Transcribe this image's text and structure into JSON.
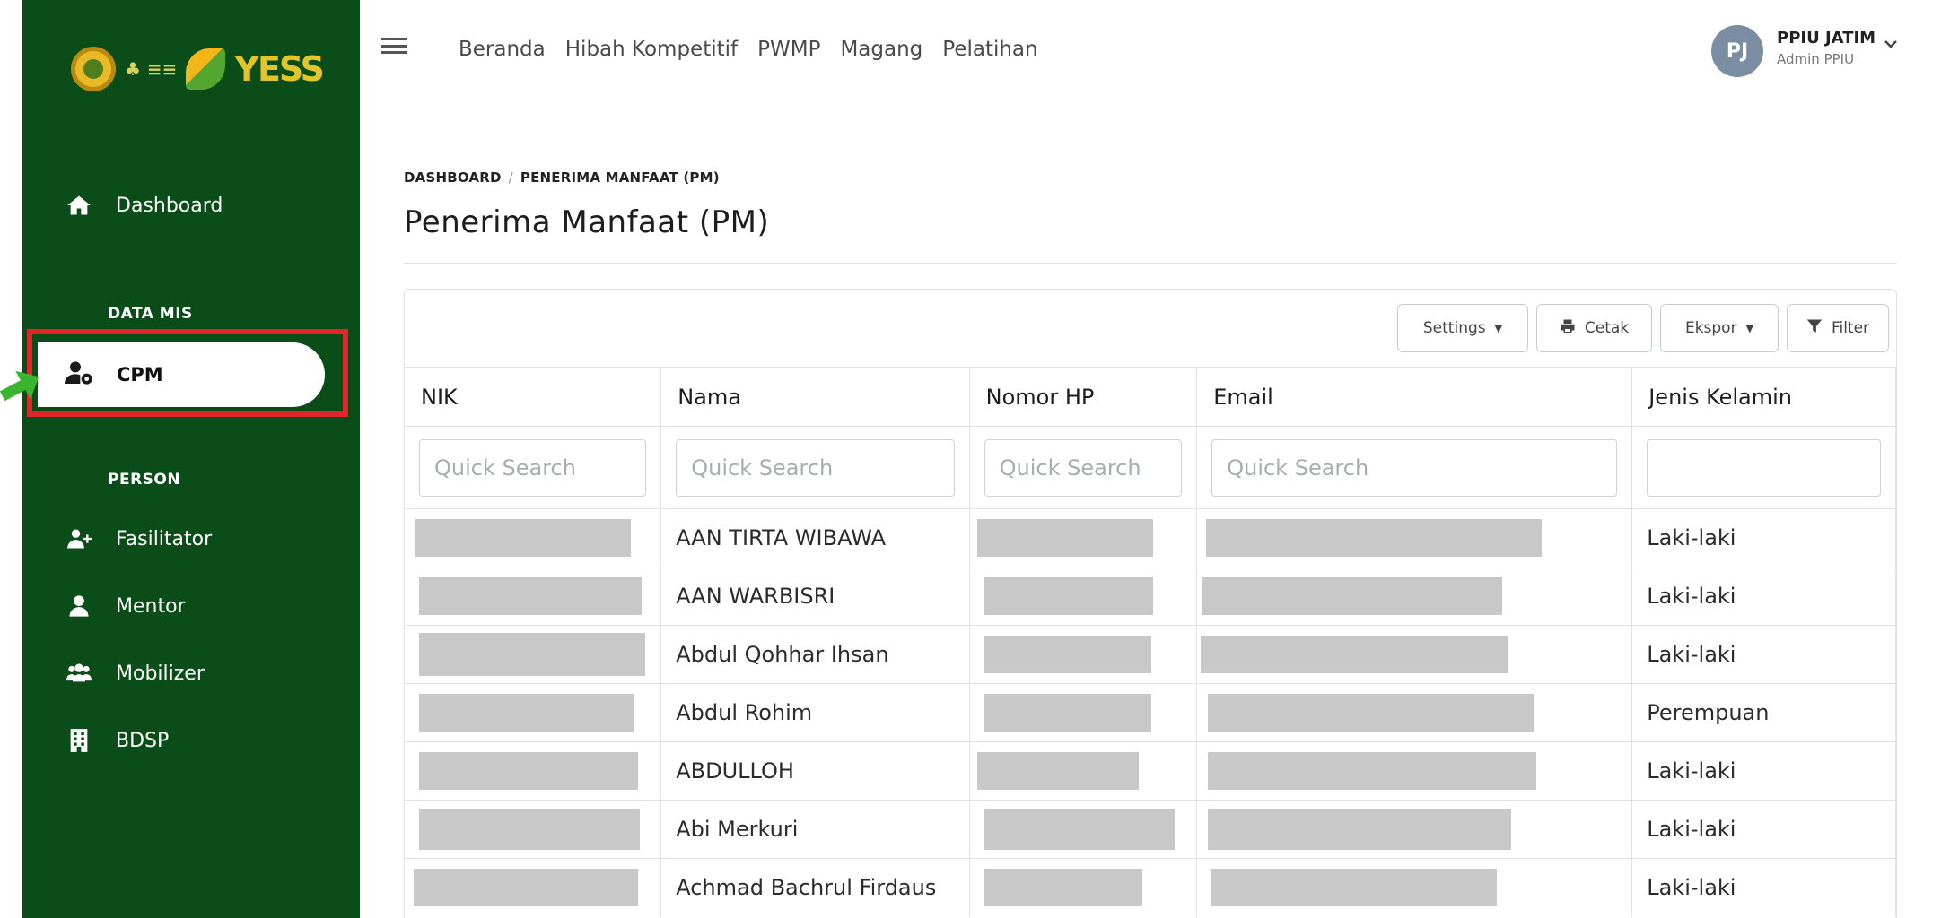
{
  "sidebar": {
    "logo_text": "YESS",
    "dashboard_label": "Dashboard",
    "section_data_mis": "DATA MIS",
    "cpm_label": "CPM",
    "section_person": "PERSON",
    "items": [
      {
        "label": "Fasilitator",
        "icon": "user-plus-icon"
      },
      {
        "label": "Mentor",
        "icon": "user-tie-icon"
      },
      {
        "label": "Mobilizer",
        "icon": "users-icon"
      },
      {
        "label": "BDSP",
        "icon": "building-icon"
      }
    ]
  },
  "topbar": {
    "nav": [
      "Beranda",
      "Hibah Kompetitif",
      "PWMP",
      "Magang",
      "Pelatihan"
    ],
    "user": {
      "initials": "PJ",
      "name": "PPIU JATIM",
      "role": "Admin PPIU"
    }
  },
  "breadcrumb": {
    "root": "DASHBOARD",
    "current": "PENERIMA MANFAAT (PM)"
  },
  "page_title": "Penerima Manfaat (PM)",
  "toolbar": {
    "settings_label": "Settings",
    "print_label": "Cetak",
    "export_label": "Ekspor",
    "filter_label": "Filter"
  },
  "table": {
    "columns": [
      "NIK",
      "Nama",
      "Nomor HP",
      "Email",
      "Jenis Kelamin"
    ],
    "search_placeholder": "Quick Search",
    "rows": [
      {
        "nama": "AAN TIRTA WIBAWA",
        "jenis_kelamin": "Laki-laki"
      },
      {
        "nama": "AAN WARBISRI",
        "jenis_kelamin": "Laki-laki"
      },
      {
        "nama": "Abdul Qohhar Ihsan",
        "jenis_kelamin": "Laki-laki"
      },
      {
        "nama": "Abdul Rohim",
        "jenis_kelamin": "Perempuan"
      },
      {
        "nama": "ABDULLOH",
        "jenis_kelamin": "Laki-laki"
      },
      {
        "nama": "Abi Merkuri",
        "jenis_kelamin": "Laki-laki"
      },
      {
        "nama": "Achmad Bachrul Firdaus",
        "jenis_kelamin": "Laki-laki"
      }
    ]
  },
  "colors": {
    "sidebar": "#0b4d18",
    "highlight": "#e0262b",
    "arrow": "#3cb52e"
  }
}
